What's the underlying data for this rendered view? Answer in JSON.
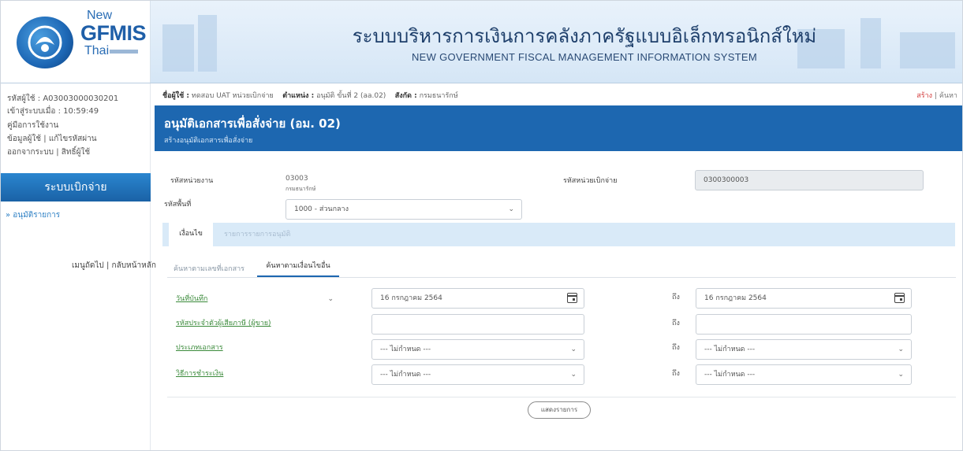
{
  "header": {
    "logo_new": "New",
    "logo_gfmis": "GFMIS",
    "logo_thai": "Thai",
    "title_th": "ระบบบริหารการเงินการคลังภาครัฐแบบอิเล็กทรอนิกส์ใหม่",
    "title_en": "NEW GOVERNMENT FISCAL MANAGEMENT INFORMATION SYSTEM"
  },
  "sidebar": {
    "user_code_label": "รหัสผู้ใช้ :",
    "user_code": "A03003000030201",
    "login_time_label": "เข้าสู่ระบบเมื่อ :",
    "login_time": "10:59:49",
    "manual": "คู่มือการใช้งาน",
    "user_info": "ข้อมูลผู้ใช้",
    "change_password": "แก้ไขรหัสผ่าน",
    "logout": "ออกจากระบบ",
    "user_rights": "สิทธิ์ผู้ใช้",
    "system_banner": "ระบบเบิกจ่าย",
    "approve_menu": "» อนุมัติรายการ",
    "main_menu": "เมนูถัดไป",
    "back_home": "กลับหน้าหลัก"
  },
  "topbar": {
    "user_label": "ชื่อผู้ใช้ :",
    "user_value": "ทดสอบ UAT หน่วยเบิกจ่าย",
    "position_label": "ตำแหน่ง :",
    "position_value": "อนุมัติ ขั้นที่ 2 (aa.02)",
    "affiliation_label": "สังกัด :",
    "affiliation_value": "กรมธนารักษ์",
    "create_link": "สร้าง",
    "search_link": "ค้นหา"
  },
  "page": {
    "title": "อนุมัติเอกสารเพื่อสั่งจ่าย (อม. 02)",
    "subtitle": "สร้างอนุมัติเอกสารเพื่อสั่งจ่าย"
  },
  "form": {
    "agency_label": "รหัสหน่วยงาน",
    "agency_code": "03003",
    "agency_name": "กรมธนารักษ์",
    "disb_unit_label": "รหัสหน่วยเบิกจ่าย",
    "disb_unit_value": "0300300003",
    "area_label": "รหัสพื้นที่",
    "area_value": "1000 - ส่วนกลาง"
  },
  "tabs": {
    "condition": "เงื่อนไข",
    "list": "รายการรายการอนุมัติ"
  },
  "subtabs": {
    "by_doc": "ค้นหาตามเลขที่เอกสาร",
    "by_other": "ค้นหาตามเงื่อนไขอื่น"
  },
  "criteria": {
    "to_label": "ถึง",
    "row1_label": "วันที่บันทึก",
    "row1_from": "16 กรกฎาคม 2564",
    "row1_to": "16 กรกฎาคม 2564",
    "row2_label": "รหัสประจำตัวผู้เสียภาษี (ผู้ขาย)",
    "row2_from": "",
    "row2_to": "",
    "row3_label": "ประเภทเอกสาร",
    "row3_from": "--- ไม่กำหนด ---",
    "row3_to": "--- ไม่กำหนด ---",
    "row4_label": "วิธีการชำระเงิน",
    "row4_from": "--- ไม่กำหนด ---",
    "row4_to": "--- ไม่กำหนด ---",
    "show_button": "แสดงรายการ"
  }
}
